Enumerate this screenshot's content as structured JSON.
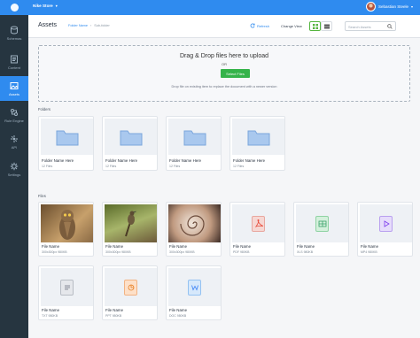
{
  "topbar": {
    "workspace": "Nike Store",
    "user": "Sebastian Steele"
  },
  "sidebar": {
    "items": [
      {
        "label": "Schemas",
        "icon": "schema-icon"
      },
      {
        "label": "Content",
        "icon": "content-icon"
      },
      {
        "label": "Assets",
        "icon": "assets-icon",
        "active": true
      },
      {
        "label": "Rule Engine",
        "icon": "rule-engine-icon"
      },
      {
        "label": "API",
        "icon": "api-icon"
      },
      {
        "label": "Settings",
        "icon": "settings-icon"
      }
    ]
  },
  "header": {
    "title": "Assets",
    "breadcrumb": [
      "Folder Name",
      "Sub-folder"
    ],
    "refresh": "Refresh",
    "change_view": "Change View",
    "search_placeholder": "Search Assets"
  },
  "dropzone": {
    "title": "Drag & Drop files here to upload",
    "or": "OR",
    "button": "Select Files",
    "hint": "Drop file on existing item to replace the document with a newer version"
  },
  "sections": {
    "folders": "Folders",
    "files": "Files"
  },
  "folders": [
    {
      "name": "Folder Name Here",
      "meta": "12 Files"
    },
    {
      "name": "Folder Name Here",
      "meta": "12 Files"
    },
    {
      "name": "Folder Name Here",
      "meta": "12 Files"
    },
    {
      "name": "Folder Name Here",
      "meta": "12 Files"
    }
  ],
  "files": [
    {
      "name": "File Name",
      "meta": "300x300px 980KB",
      "kind": "image-owl"
    },
    {
      "name": "File Name",
      "meta": "300x300px 980KB",
      "kind": "image-bird"
    },
    {
      "name": "File Name",
      "meta": "300x300px 980KB",
      "kind": "image-shell"
    },
    {
      "name": "File Name",
      "meta": "PDF 980KB",
      "kind": "pdf",
      "color": "#e74c3c",
      "bg": "#f6d7d3"
    },
    {
      "name": "File Name",
      "meta": "XLS 980KB",
      "kind": "xls",
      "color": "#38a169",
      "bg": "#d4f0dc"
    },
    {
      "name": "File Name",
      "meta": "MP4 980KB",
      "kind": "video",
      "color": "#7c3aed",
      "bg": "#e6dcfb"
    },
    {
      "name": "File Name",
      "meta": "TXT 980KB",
      "kind": "txt",
      "color": "#6b7280",
      "bg": "#e5e7eb"
    },
    {
      "name": "File Name",
      "meta": "PPT 980KB",
      "kind": "ppt",
      "color": "#e67e22",
      "bg": "#fde0c8"
    },
    {
      "name": "File Name",
      "meta": "DOC 980KB",
      "kind": "doc",
      "color": "#3b82f6",
      "bg": "#d6e8fb"
    }
  ],
  "colors": {
    "brand": "#2f8bef",
    "sidebar": "#263540",
    "accent_green": "#35b34a"
  }
}
